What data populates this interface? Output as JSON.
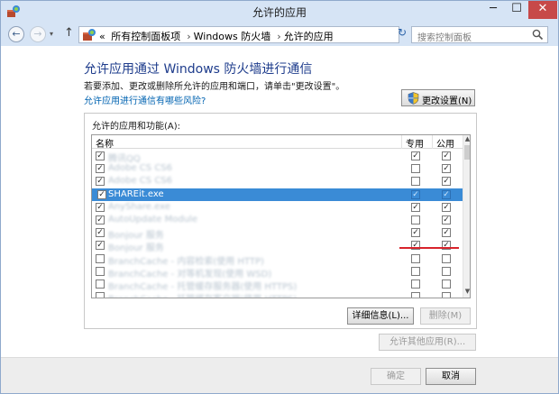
{
  "window": {
    "title": "允许的应用"
  },
  "titlebar": {
    "minimize": "─",
    "maximize": "☐",
    "close": "✕"
  },
  "nav": {
    "back": "←",
    "forward": "→",
    "history": "▾",
    "up": "↑",
    "breadcrumbs": [
      "«",
      "所有控制面板项",
      "Windows 防火墙",
      "允许的应用"
    ],
    "separator": "›",
    "dropdown": "▾",
    "refresh": "↻",
    "search_placeholder": "搜索控制面板"
  },
  "content": {
    "heading": "允许应用通过 Windows 防火墙进行通信",
    "description": "若要添加、更改或删除所允许的应用和端口，请单击\"更改设置\"。",
    "risk_link": "允许应用进行通信有哪些风险?",
    "change_settings": "更改设置(N)",
    "group_label": "允许的应用和功能(A):",
    "columns": {
      "name": "名称",
      "private": "专用",
      "public": "公用"
    },
    "rows": [
      {
        "name": "腾讯QQ",
        "enabled": true,
        "private": true,
        "public": true,
        "selected": false
      },
      {
        "name": "Adobe CS CS6",
        "enabled": true,
        "private": false,
        "public": true,
        "selected": false
      },
      {
        "name": "Adobe CS CS6",
        "enabled": true,
        "private": false,
        "public": true,
        "selected": false
      },
      {
        "name": "SHAREit.exe",
        "enabled": true,
        "private": true,
        "public": true,
        "selected": true
      },
      {
        "name": "AnyShare.exe",
        "enabled": true,
        "private": true,
        "public": true,
        "selected": false
      },
      {
        "name": "AutoUpdate Module",
        "enabled": true,
        "private": false,
        "public": true,
        "selected": false
      },
      {
        "name": "Bonjour 服务",
        "enabled": true,
        "private": true,
        "public": true,
        "selected": false
      },
      {
        "name": "Bonjour 服务",
        "enabled": true,
        "private": true,
        "public": true,
        "selected": false
      },
      {
        "name": "BranchCache - 内容检索(使用 HTTP)",
        "enabled": false,
        "private": false,
        "public": false,
        "selected": false
      },
      {
        "name": "BranchCache - 对等机发现(使用 WSD)",
        "enabled": false,
        "private": false,
        "public": false,
        "selected": false
      },
      {
        "name": "BranchCache - 托管缓存服务器(使用 HTTPS)",
        "enabled": false,
        "private": false,
        "public": false,
        "selected": false
      },
      {
        "name": "BranchCache - 托管缓存客户端(使用 HTTPS)",
        "enabled": false,
        "private": false,
        "public": false,
        "selected": false
      }
    ],
    "details_button": "详细信息(L)...",
    "remove_button": "删除(M)",
    "allow_other_button": "允许其他应用(R)..."
  },
  "footer": {
    "ok": "确定",
    "cancel": "取消"
  },
  "colors": {
    "accent": "#3a8bd6",
    "heading": "#1e3c8c",
    "link": "#0063b1",
    "underline": "#d8242c"
  },
  "scroll": {
    "up": "▲",
    "down": "▼"
  }
}
